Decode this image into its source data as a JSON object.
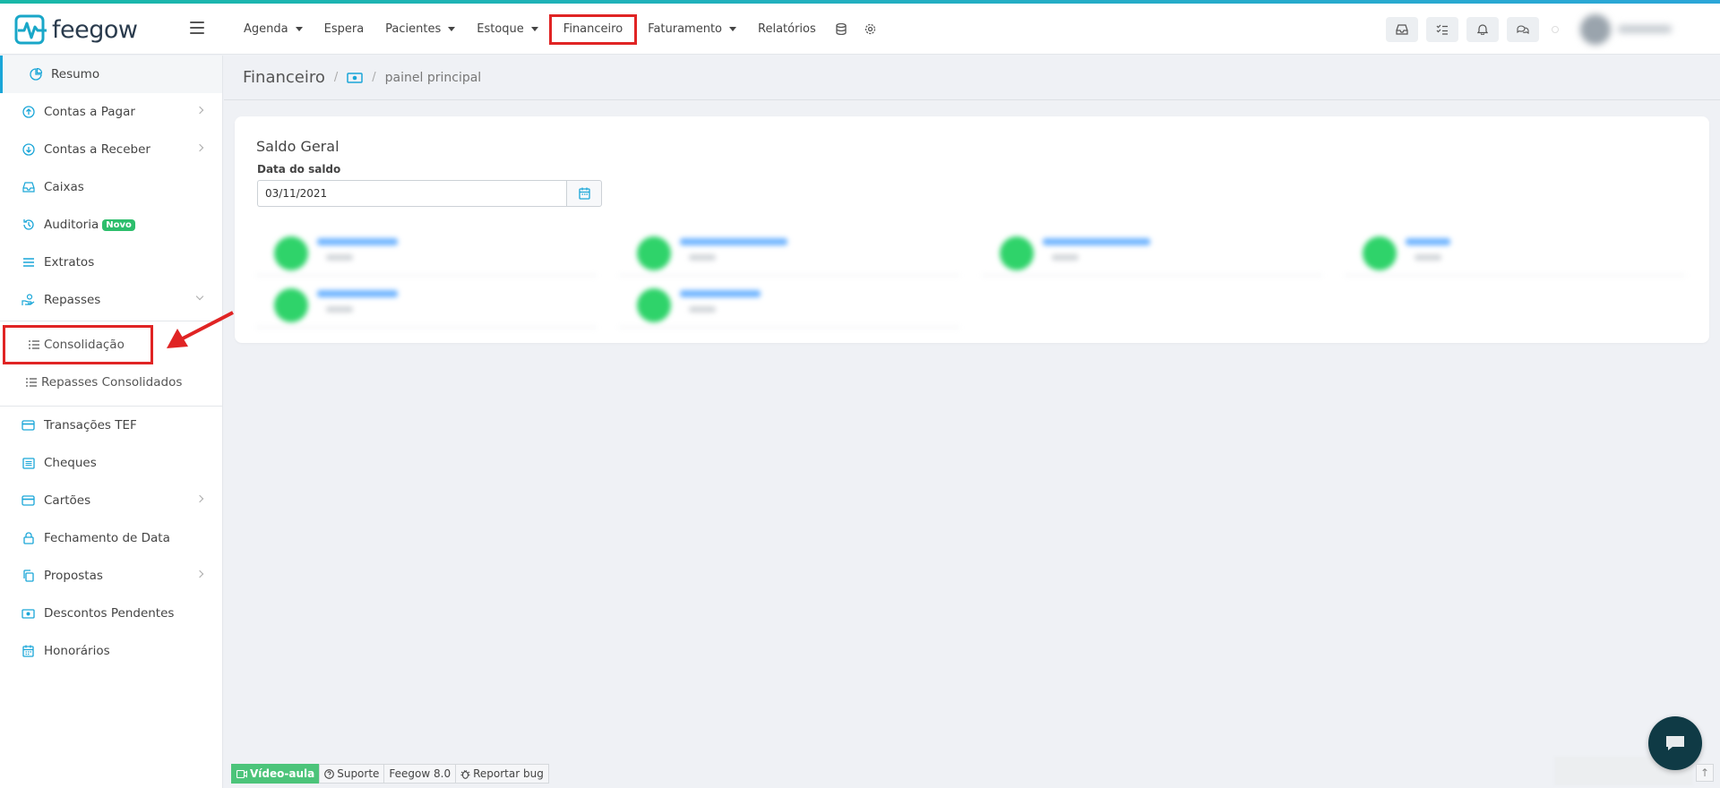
{
  "app": {
    "logo_text": "feegow"
  },
  "topnav": {
    "items": [
      {
        "label": "Agenda",
        "dropdown": true
      },
      {
        "label": "Espera",
        "dropdown": false
      },
      {
        "label": "Pacientes",
        "dropdown": true
      },
      {
        "label": "Estoque",
        "dropdown": true
      },
      {
        "label": "Financeiro",
        "dropdown": false,
        "highlighted": true
      },
      {
        "label": "Faturamento",
        "dropdown": true
      },
      {
        "label": "Relatórios",
        "dropdown": false
      }
    ],
    "icons": [
      "database-icon",
      "gear-icon"
    ]
  },
  "header_right": {
    "icons": [
      "inbox-icon",
      "checklist-icon",
      "bell-icon",
      "chat-bubbles-icon"
    ]
  },
  "sidebar": {
    "items": [
      {
        "label": "Resumo",
        "icon": "pie-chart-icon",
        "active": true
      },
      {
        "label": "Contas a Pagar",
        "icon": "arrow-up-circle-icon",
        "chevron": true
      },
      {
        "label": "Contas a Receber",
        "icon": "arrow-down-circle-icon",
        "chevron": true
      },
      {
        "label": "Caixas",
        "icon": "inbox-icon"
      },
      {
        "label": "Auditoria",
        "icon": "history-icon",
        "badge": "Novo"
      },
      {
        "label": "Extratos",
        "icon": "list-icon"
      },
      {
        "label": "Repasses",
        "icon": "hand-coins-icon",
        "chevron": "down"
      }
    ],
    "sub_items": [
      {
        "label": "Consolidação",
        "marked": true
      },
      {
        "label": "Repasses Consolidados"
      }
    ],
    "items_after": [
      {
        "label": "Transações TEF",
        "icon": "credit-card-icon"
      },
      {
        "label": "Cheques",
        "icon": "cheque-icon"
      },
      {
        "label": "Cartões",
        "icon": "card-icon",
        "chevron": true
      },
      {
        "label": "Fechamento de Data",
        "icon": "lock-icon"
      },
      {
        "label": "Propostas",
        "icon": "copy-icon",
        "chevron": true
      },
      {
        "label": "Descontos Pendentes",
        "icon": "money-icon"
      },
      {
        "label": "Honorários",
        "icon": "calendar-icon"
      }
    ]
  },
  "breadcrumb": {
    "title": "Financeiro",
    "separator": "/",
    "page": "painel principal"
  },
  "saldo": {
    "title": "Saldo Geral",
    "date_label": "Data do saldo",
    "date_value": "03/11/2021"
  },
  "footer": {
    "video": "Vídeo-aula",
    "support": "Suporte",
    "version": "Feegow 8.0",
    "bug": "Reportar bug"
  },
  "colors": {
    "accent": "#1aa6d8",
    "highlight": "#e02424",
    "green": "#2dbe6c"
  }
}
